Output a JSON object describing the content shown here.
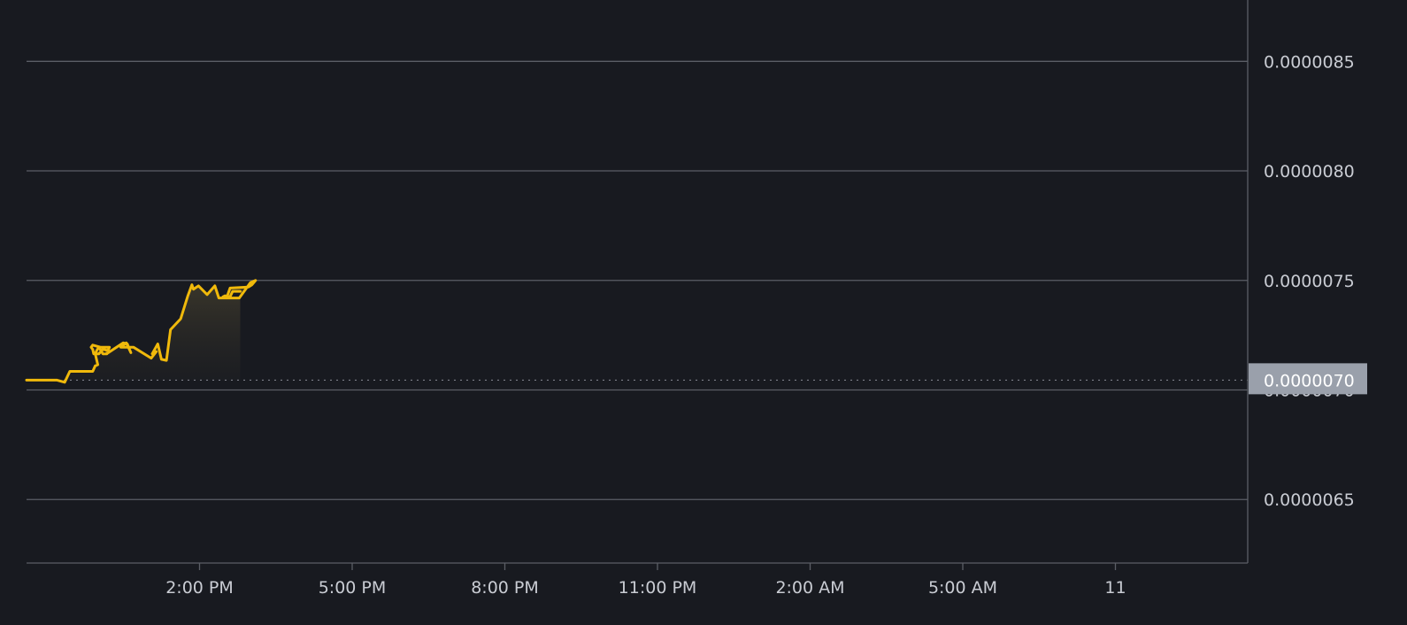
{
  "chart_data": {
    "type": "area",
    "title": "",
    "xlabel": "",
    "ylabel": "",
    "ylim": [
      6.21e-06,
      8.78e-06
    ],
    "xlim": [
      0,
      24
    ],
    "x_unit": "hours elapsed since the first data point",
    "y_ticks": [
      "0.0000065",
      "0.0000070",
      "0.0000075",
      "0.0000080",
      "0.0000085"
    ],
    "y_tick_values": [
      6.5e-06,
      7e-06,
      7.5e-06,
      8e-06,
      8.5e-06
    ],
    "x_ticks": [
      "2:00 PM",
      "5:00 PM",
      "8:00 PM",
      "11:00 PM",
      "2:00 AM",
      "5:00 AM",
      "11"
    ],
    "x_tick_values": [
      3.4,
      6.4,
      9.4,
      12.4,
      15.4,
      18.4,
      21.4
    ],
    "current_price_label": "0.0000070",
    "baseline": 7.045e-06,
    "colors": {
      "line": "#f0b90b",
      "background": "#181a20",
      "grid": "#5b5e66",
      "tick_text": "#c9ccd3",
      "price_tag": "#9aa0ab"
    },
    "grid": true,
    "series": [
      {
        "x": [
          0,
          0.6,
          0.75,
          0.85,
          1.3,
          1.35,
          1.4,
          1.35,
          1.38,
          1.42,
          1.5,
          1.58,
          1.6,
          1.5,
          1.42,
          1.32,
          1.3,
          1.27,
          1.3,
          1.45,
          1.63,
          1.57,
          1.9,
          1.98,
          2.05,
          1.96,
          1.85,
          2.1,
          2.45,
          2.55,
          2.47,
          2.58,
          2.65,
          2.75,
          2.83,
          3.03,
          3.17,
          3.25,
          3.28,
          3.38,
          3.55,
          3.7,
          3.78,
          3.86,
          4.18,
          4.4,
          4.5,
          4.43,
          4.36,
          4.0,
          3.94,
          3.86,
          3.9,
          4.0,
          4.05,
          4.1,
          4.2
        ],
        "y": [
          7.045e-06,
          7.045e-06,
          7.035e-06,
          7.085e-06,
          7.085e-06,
          7.11e-06,
          7.115e-06,
          7.165e-06,
          7.18e-06,
          7.195e-06,
          7.165e-06,
          7.165e-06,
          7.18e-06,
          7.185e-06,
          7.165e-06,
          7.165e-06,
          7.185e-06,
          7.195e-06,
          7.205e-06,
          7.195e-06,
          7.195e-06,
          7.165e-06,
          7.215e-06,
          7.21e-06,
          7.17e-06,
          7.215e-06,
          7.195e-06,
          7.195e-06,
          7.145e-06,
          7.175e-06,
          7.165e-06,
          7.21e-06,
          7.14e-06,
          7.135e-06,
          7.275e-06,
          7.325e-06,
          7.43e-06,
          7.48e-06,
          7.46e-06,
          7.475e-06,
          7.435e-06,
          7.475e-06,
          7.42e-06,
          7.42e-06,
          7.42e-06,
          7.49e-06,
          7.5e-06,
          7.48e-06,
          7.47e-06,
          7.465e-06,
          7.425e-06,
          7.425e-06,
          7.43e-06,
          7.425e-06,
          7.45e-06,
          7.45e-06,
          7.45e-06
        ]
      }
    ]
  }
}
